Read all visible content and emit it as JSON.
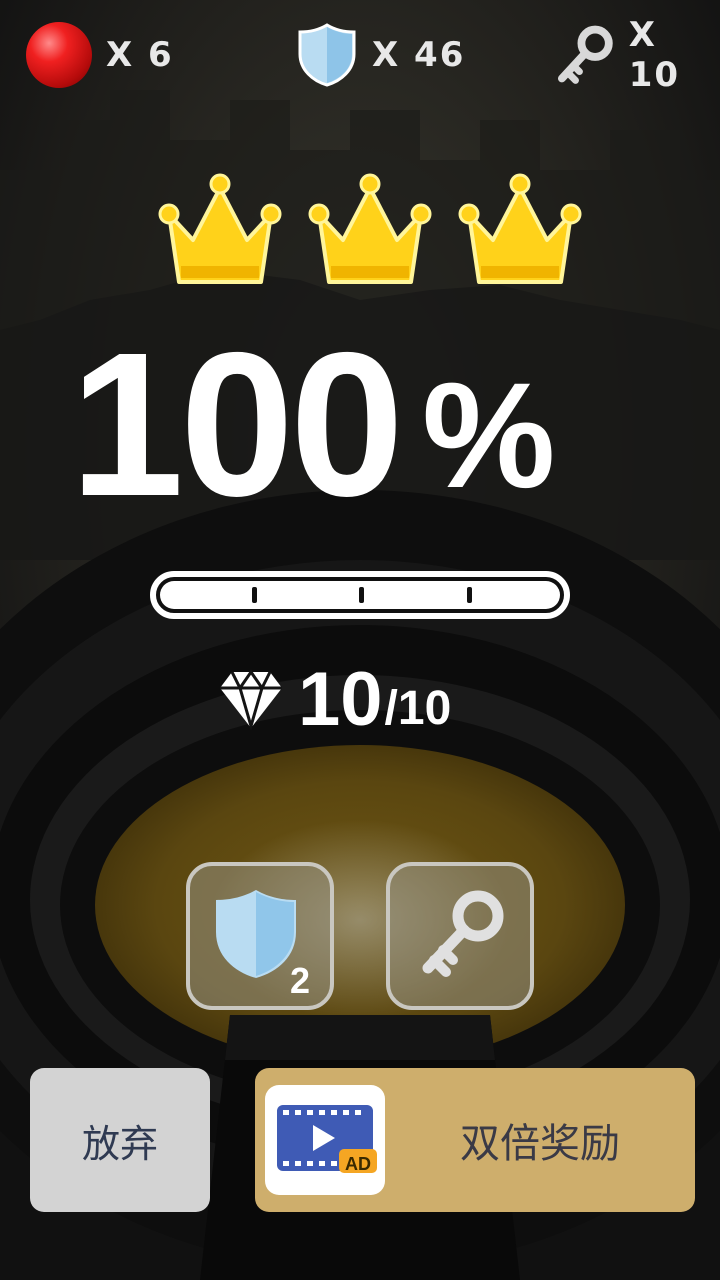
{
  "resources": {
    "balls": {
      "icon": "red-ball-icon",
      "text": "X 6"
    },
    "shields": {
      "icon": "shield-icon",
      "text": "X 46"
    },
    "keys": {
      "icon": "key-icon",
      "text": "X 10"
    }
  },
  "result": {
    "crowns_earned": 3,
    "crowns_total": 3,
    "percent_value": "100",
    "percent_sign": "%",
    "progress_fraction": 1.0,
    "gems_collected": "10",
    "gems_total": "/10"
  },
  "rewards": {
    "shield": {
      "icon": "shield-icon",
      "count": "2"
    },
    "key": {
      "icon": "key-icon"
    }
  },
  "buttons": {
    "abandon_label": "放弃",
    "double_label": "双倍奖励",
    "ad_badge": "AD"
  },
  "colors": {
    "ball_red": "#e31b1b",
    "shield_blue": "#b9dcf2",
    "crown_gold": "#ffd21a",
    "double_button": "#ceae6c",
    "abandon_button": "#d3d3d3",
    "ad_video_blue": "#3f5bb5",
    "ad_badge_orange": "#f5a623"
  }
}
